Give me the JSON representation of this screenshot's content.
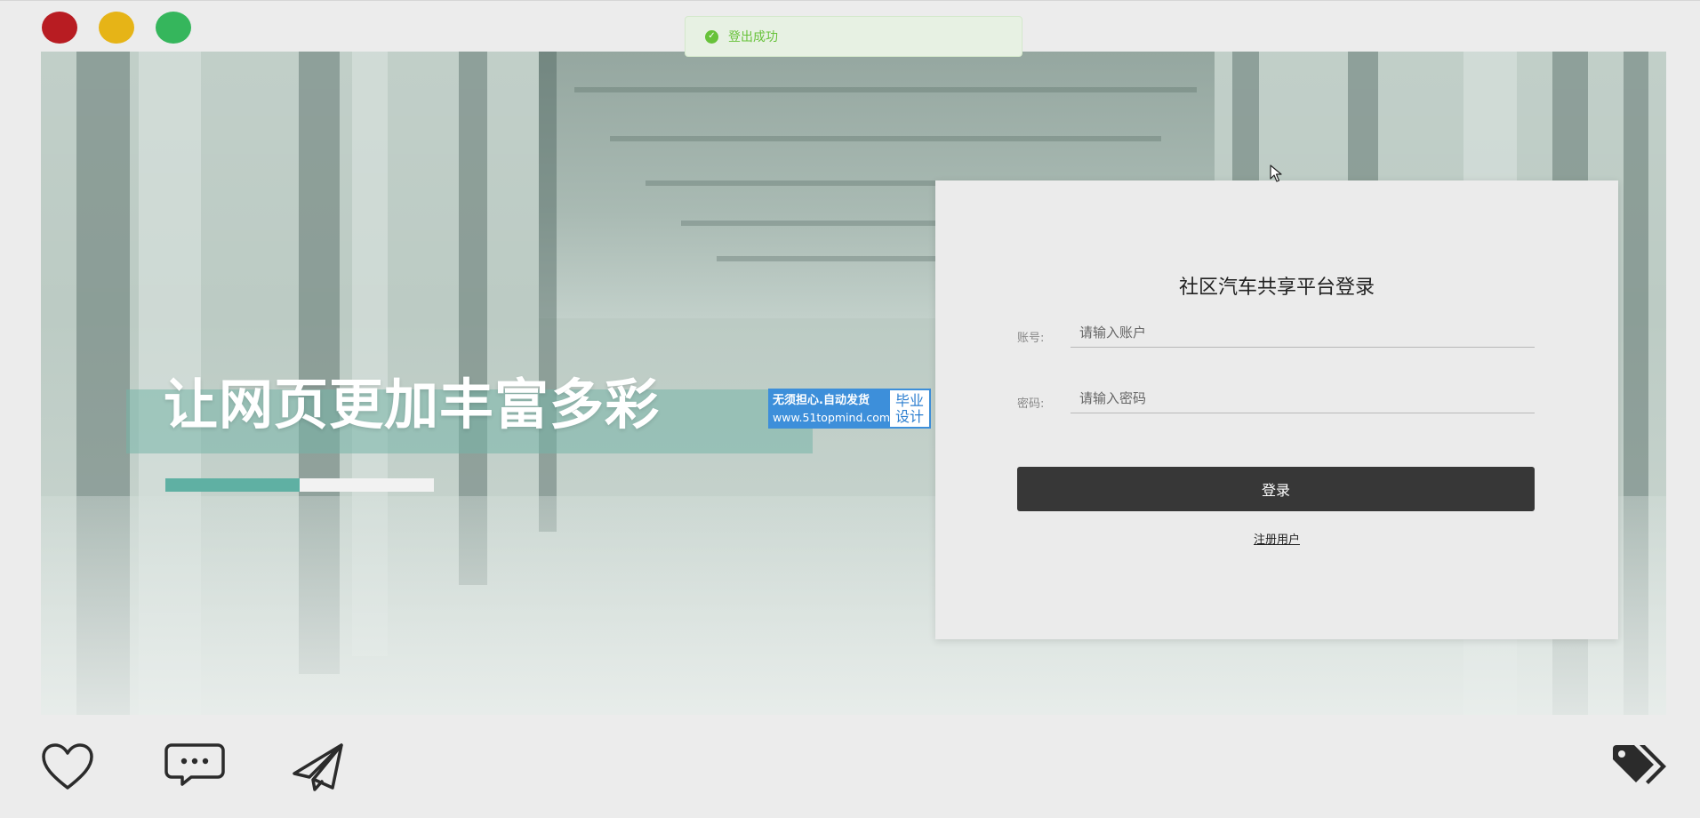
{
  "window_controls": {
    "close_color": "#b81c22",
    "minimize_color": "#e6b417",
    "maximize_color": "#35b65c"
  },
  "toast": {
    "text": "登出成功",
    "icon": "check-circle-icon",
    "icon_color": "#67c23a",
    "text_color": "#67c23a"
  },
  "hero": {
    "heading": "让网页更加丰富多彩",
    "progress": 0.5,
    "progress_color": "#5fb0a3"
  },
  "ad_badge": {
    "line1": "无须担心.自动发货",
    "line2": "www.51topmind.com",
    "tag_line1": "毕业",
    "tag_line2": "设计"
  },
  "login": {
    "title": "社区汽车共享平台登录",
    "account_label": "账号:",
    "account_placeholder": "请输入账户",
    "password_label": "密码:",
    "password_placeholder": "请输入密码",
    "submit_label": "登录",
    "register_link": "注册用户"
  },
  "bottom_bar": {
    "icons": [
      "heart-icon",
      "comment-icon",
      "send-icon",
      "tags-icon"
    ]
  }
}
